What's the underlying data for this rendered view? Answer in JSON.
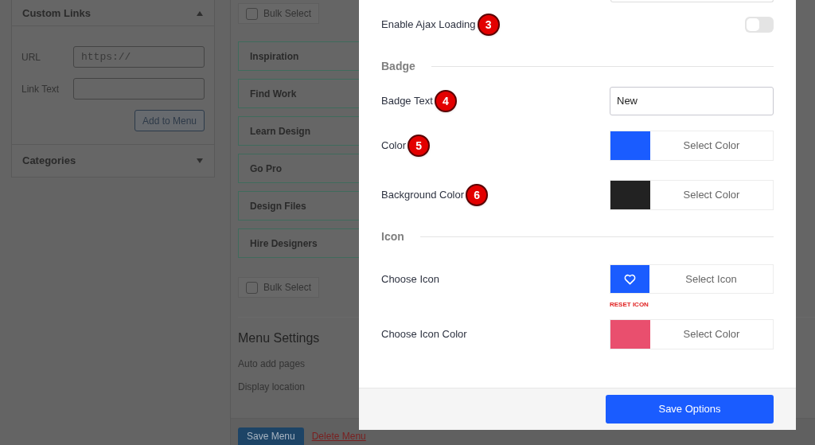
{
  "sidebar": {
    "panels": [
      {
        "title": "Custom Links",
        "expanded": true,
        "fields": [
          {
            "label": "URL",
            "value": "https://"
          },
          {
            "label": "Link Text"
          }
        ],
        "button": "Add to Menu"
      },
      {
        "title": "Categories",
        "expanded": false
      }
    ]
  },
  "menu_structure": {
    "bulk_select_top": {
      "label": "Bulk Select",
      "checked": false
    },
    "items": [
      "Inspiration",
      "Find Work",
      "Learn Design",
      "Go Pro",
      "Design Files",
      "Hire Designers"
    ],
    "bulk_select_bottom": {
      "label": "Bulk Select",
      "checked": false
    },
    "menu_settings": {
      "title": "Menu Settings",
      "rows": [
        "Auto add pages",
        "Display location"
      ]
    },
    "save_button": "Save Menu",
    "delete_link": "Delete Menu"
  },
  "modal": {
    "rows": [
      {
        "kind": "toggle",
        "label": "Enable Ajax Loading",
        "step": "3",
        "on": false
      },
      {
        "kind": "heading",
        "label": "Badge"
      },
      {
        "kind": "text",
        "label": "Badge Text",
        "step": "4",
        "value": "New"
      },
      {
        "kind": "color",
        "label": "Color",
        "step": "5",
        "color": "#1a5cff",
        "button": "Select Color"
      },
      {
        "kind": "color",
        "label": "Background Color",
        "step": "6",
        "color": "#222222",
        "button": "Select Color"
      },
      {
        "kind": "heading",
        "label": "Icon"
      },
      {
        "kind": "icon",
        "label": "Choose Icon",
        "button": "Select Icon",
        "reset": "RESET ICON"
      },
      {
        "kind": "color",
        "label": "Choose Icon Color",
        "color": "#e94f6e",
        "button": "Select Color"
      }
    ],
    "save_button": "Save Options"
  }
}
